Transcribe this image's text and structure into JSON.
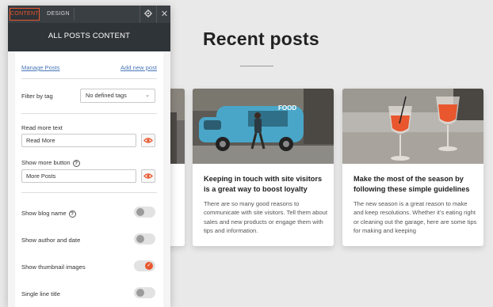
{
  "panel": {
    "tabs": [
      {
        "label": "CONTENT",
        "active": true
      },
      {
        "label": "DESIGN",
        "active": false
      }
    ],
    "settings_icon": "gear-icon",
    "close_icon": "close-icon",
    "header_title": "ALL POSTS CONTENT",
    "links": {
      "manage": "Manage Posts",
      "add_new": "Add new post"
    },
    "filter": {
      "label": "Filter by tag",
      "selected": "No defined tags"
    },
    "read_more": {
      "label": "Read more text",
      "value": "Read More"
    },
    "show_more": {
      "label": "Show more button",
      "value": "More Posts"
    },
    "toggles": [
      {
        "label": "Show blog name",
        "on": false,
        "help": true
      },
      {
        "label": "Show author and date",
        "on": false,
        "help": false
      },
      {
        "label": "Show thumbnail images",
        "on": true,
        "help": false
      },
      {
        "label": "Single line title",
        "on": false,
        "help": false
      }
    ],
    "accent_color": "#e8572e",
    "dark_color": "#2f3438"
  },
  "canvas": {
    "title": "Recent posts",
    "posts": [
      {
        "title": "Keeping in touch with site visitors is a great way to boost loyalty",
        "excerpt": "There are so many good reasons to communicate with site visitors. Tell them about sales and new products or engage them with tips and information.",
        "image": "food-truck-photo"
      },
      {
        "title": "Make the most of the season by following these simple guidelines",
        "excerpt": "The new season is a great reason to make and keep resolutions. Whether it’s eating right or cleaning out the garage, here are some tips for making and keeping",
        "image": "cocktail-glasses-photo"
      }
    ]
  }
}
